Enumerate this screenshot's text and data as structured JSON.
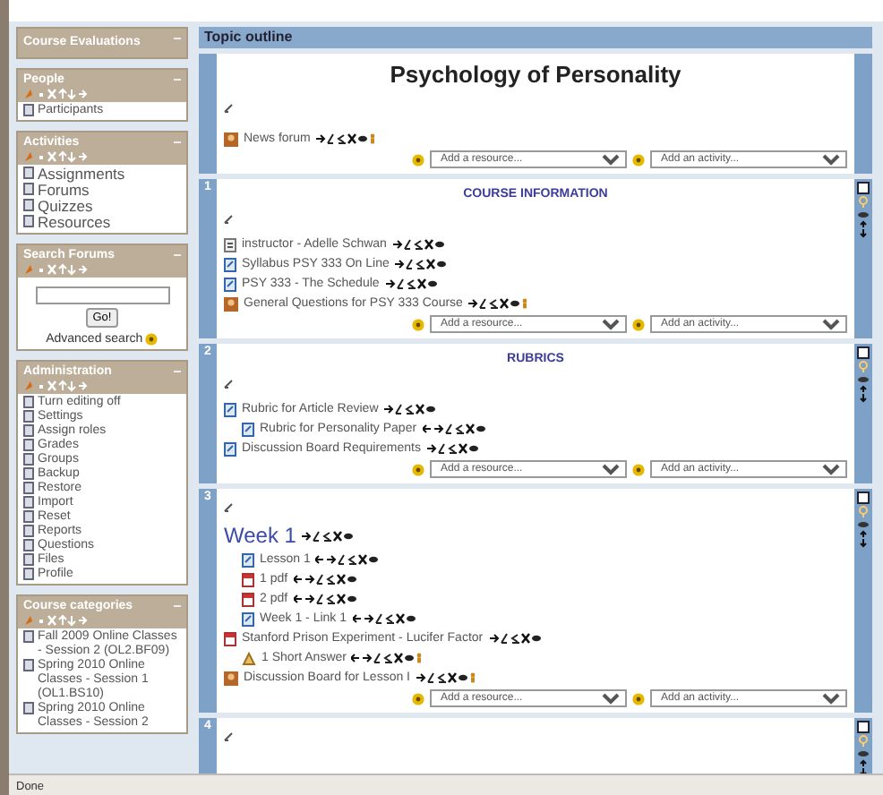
{
  "sidebar": {
    "blocks": [
      {
        "title": "Course Evaluations",
        "kind": "collapsed"
      },
      {
        "title": "People",
        "kind": "list",
        "items": [
          {
            "label": "Participants"
          }
        ]
      },
      {
        "title": "Activities",
        "kind": "list",
        "items": [
          {
            "label": "Assignments"
          },
          {
            "label": "Forums"
          },
          {
            "label": "Quizzes"
          },
          {
            "label": "Resources"
          }
        ]
      },
      {
        "title": "Search Forums",
        "kind": "search",
        "button": "Go!",
        "link": "Advanced search"
      },
      {
        "title": "Administration",
        "kind": "list",
        "items": [
          {
            "label": "Turn editing off"
          },
          {
            "label": "Settings"
          },
          {
            "label": "Assign roles"
          },
          {
            "label": "Grades"
          },
          {
            "label": "Groups"
          },
          {
            "label": "Backup"
          },
          {
            "label": "Restore"
          },
          {
            "label": "Import"
          },
          {
            "label": "Reset"
          },
          {
            "label": "Reports"
          },
          {
            "label": "Questions"
          },
          {
            "label": "Files"
          },
          {
            "label": "Profile"
          }
        ]
      },
      {
        "title": "Course categories",
        "kind": "list",
        "items": [
          {
            "label": "Fall 2009 Online Classes - Session 2 (OL2.BF09)"
          },
          {
            "label": "Spring 2010 Online Classes - Session 1 (OL1.BS10)"
          },
          {
            "label": "Spring 2010 Online Classes - Session 2"
          }
        ]
      }
    ]
  },
  "main": {
    "header": "Topic outline",
    "sections": [
      {
        "kind": "course",
        "title": "Psychology of Personality",
        "items": [
          {
            "label": "News forum",
            "kind": "forum"
          }
        ],
        "add_resource": "Add a resource...",
        "add_activity": "Add an activity..."
      },
      {
        "kind": "topic",
        "number": "1",
        "title": "COURSE INFORMATION",
        "items": [
          {
            "label": "instructor - Adelle Schwan",
            "kind": "page"
          },
          {
            "label": "Syllabus PSY 333 On Line",
            "kind": "link"
          },
          {
            "label": "PSY 333 - The Schedule",
            "kind": "link"
          },
          {
            "label": "General Questions for PSY 333 Course",
            "kind": "forum"
          }
        ],
        "add_resource": "Add a resource...",
        "add_activity": "Add an activity..."
      },
      {
        "kind": "topic",
        "number": "2",
        "title": "RUBRICS",
        "items": [
          {
            "label": "Rubric for Article Review",
            "kind": "link",
            "children": [
              {
                "label": "Rubric for Personality Paper",
                "kind": "link"
              }
            ]
          },
          {
            "label": "Discussion Board Requirements",
            "kind": "link"
          }
        ],
        "add_resource": "Add a resource...",
        "add_activity": "Add an activity..."
      },
      {
        "kind": "topic",
        "number": "3",
        "items": [
          {
            "label": "Week 1",
            "kind": "label",
            "children": [
              {
                "label": "Lesson 1",
                "kind": "link"
              },
              {
                "label": "1 pdf",
                "kind": "pdf"
              },
              {
                "label": "2 pdf",
                "kind": "pdf"
              },
              {
                "label": "Week 1 - Link 1",
                "kind": "link"
              }
            ]
          },
          {
            "label": "Stanford Prison Experiment - Lucifer Factor",
            "kind": "pdf",
            "children": [
              {
                "label": "1 Short Answer",
                "kind": "quiz"
              }
            ]
          },
          {
            "label": "Discussion Board for Lesson I",
            "kind": "forum"
          }
        ],
        "add_resource": "Add a resource...",
        "add_activity": "Add an activity..."
      },
      {
        "kind": "topic",
        "number": "4"
      }
    ]
  },
  "status_bar": "Done"
}
